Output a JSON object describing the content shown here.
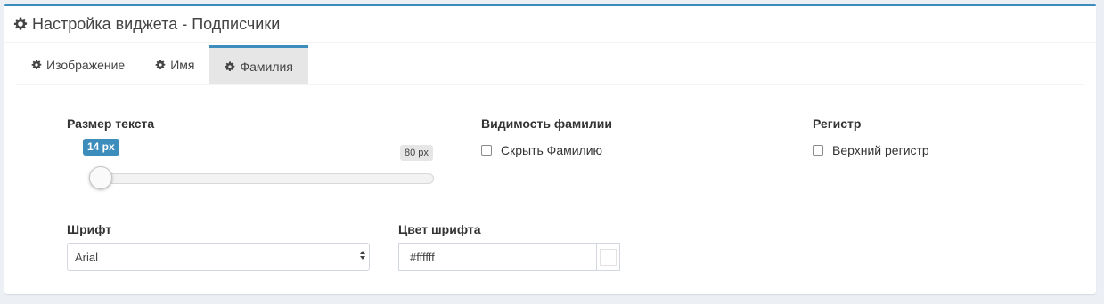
{
  "header": {
    "title": "Настройка виджета - Подписчики",
    "icon": "gear-icon"
  },
  "tabs": [
    {
      "label": "Изображение",
      "icon": "gear-icon",
      "active": false
    },
    {
      "label": "Имя",
      "icon": "gear-icon",
      "active": false
    },
    {
      "label": "Фамилия",
      "icon": "gear-icon",
      "active": true
    }
  ],
  "text_size": {
    "label": "Размер текста",
    "value_label": "14 px",
    "max_label": "80 px",
    "value": 14,
    "max": 80
  },
  "surname_visibility": {
    "label": "Видимость фамилии",
    "checkbox_label": "Скрыть Фамилию",
    "checked": false
  },
  "case": {
    "label": "Регистр",
    "checkbox_label": "Верхний регистр",
    "checked": false
  },
  "font": {
    "label": "Шрифт",
    "selected": "Arial"
  },
  "font_color": {
    "label": "Цвет шрифта",
    "value": "#ffffff"
  },
  "colors": {
    "accent": "#3c8dbc",
    "background": "#ecf0f5",
    "active_tab": "#e6e6e6"
  }
}
